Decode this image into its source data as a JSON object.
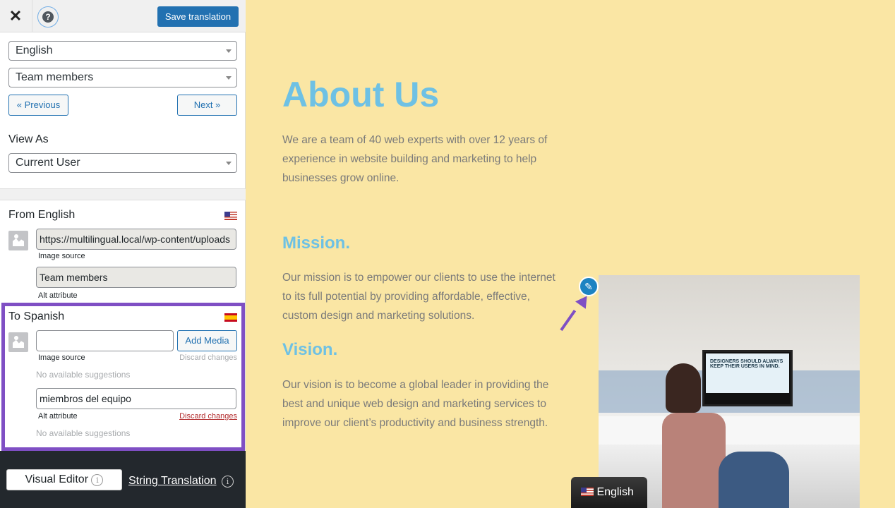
{
  "toolbar": {
    "save_label": "Save translation"
  },
  "selectors": {
    "language": "English",
    "string": "Team members",
    "previous": "« Previous",
    "next": "Next »",
    "view_as_label": "View As",
    "view_as": "Current User"
  },
  "from": {
    "title": "From English",
    "image_source": "https://multilingual.local/wp-content/uploads",
    "image_source_label": "Image source",
    "alt": "Team members",
    "alt_label": "Alt attribute"
  },
  "to": {
    "title": "To Spanish",
    "image_source": "",
    "add_media": "Add Media",
    "image_source_label": "Image source",
    "discard1": "Discard changes",
    "no_suggestions1": "No available suggestions",
    "alt": "miembros del equipo",
    "alt_label": "Alt attribute",
    "discard2": "Discard changes",
    "no_suggestions2": "No available suggestions"
  },
  "footer": {
    "visual_editor": "Visual Editor",
    "string_translation": "String Translation",
    "info": "i"
  },
  "page": {
    "title": "About Us",
    "intro": "We are a team of 40 web experts with over 12 years of experience in website building and marketing to help businesses grow online.",
    "mission_title": "Mission.",
    "mission": "Our mission is to empower our clients to use the internet to its full potential by providing affordable, effective, custom design and marketing solutions.",
    "vision_title": "Vision.",
    "vision": "Our vision is to become a global leader in providing the best and unique web design and marketing services to improve our client’s productivity and business strength.",
    "photo_text": "DESIGNERS SHOULD ALWAYS KEEP THEIR USERS IN MIND.",
    "language_switcher": "English"
  },
  "colors": {
    "accent": "#2271b1",
    "highlight": "#7f4fc4",
    "heading": "#6ec1e4",
    "background": "#fae6a4"
  }
}
